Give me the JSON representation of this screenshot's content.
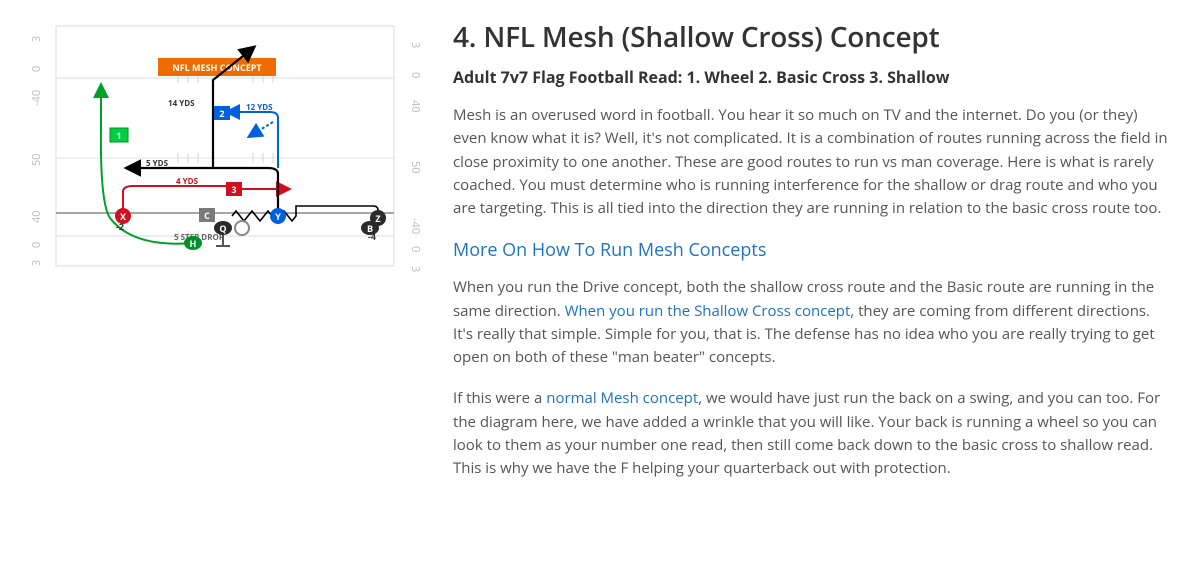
{
  "diagram": {
    "title_badge": "NFL MESH CONCEPT",
    "yards": {
      "top_left_numbers": [
        "3",
        "0",
        "-40"
      ],
      "top_right_numbers": [
        "40",
        "0",
        "3"
      ],
      "mid_numbers_left": "50",
      "mid_numbers_right": "50",
      "bottom_left_numbers": [
        "40",
        "0",
        "3"
      ],
      "bottom_right_numbers": [
        "3",
        "0",
        "-40"
      ]
    },
    "labels": {
      "route14": "14 YDS",
      "route12": "12 YDS",
      "route5": "5 YDS",
      "route4": "4 YDS",
      "xminus2": "-2",
      "drop": "5 STEP DROP",
      "bminus4": "-4"
    },
    "players": {
      "one": "1",
      "two": "2",
      "three": "3",
      "X": "X",
      "Y": "Y",
      "Z": "Z",
      "C": "C",
      "H": "H",
      "Q": "Q",
      "B": "B"
    }
  },
  "article": {
    "heading": "4. NFL Mesh (Shallow Cross) Concept",
    "subheading": "Adult 7v7 Flag Football Read: 1. Wheel 2. Basic Cross 3. Shallow",
    "p1": "Mesh is an overused word in football. You hear it so much on TV and the internet. Do you (or they) even know what it is? Well, it's not complicated. It is a combination of routes running across the field in close proximity to one another. These are good routes to run vs man coverage. Here is what is rarely coached. You must determine who is running interference for the shallow or drag route and who you are targeting. This is all tied into the direction they are running in relation to the basic cross route too.",
    "link_heading": "More On How To Run Mesh Concepts",
    "p2a": "When you run the Drive concept, both the shallow cross route and the Basic route are running in the same direction. ",
    "p2_link": "When you run the Shallow Cross concept,",
    "p2b": " they are coming from different directions. It's really that simple. Simple for you, that is. The defense has no idea who you are really trying to get open on both of these \"man beater\" concepts.",
    "p3a": "If this were a ",
    "p3_link": "normal Mesh concept",
    "p3b": ", we would have just run the back on a swing, and you can too. For the diagram here, we have added a wrinkle that you will like. Your back is running a wheel so you can look to them as your number one read, then still come back down to the basic cross to shallow read. This is why we have the F helping your quarterback out with protection."
  }
}
